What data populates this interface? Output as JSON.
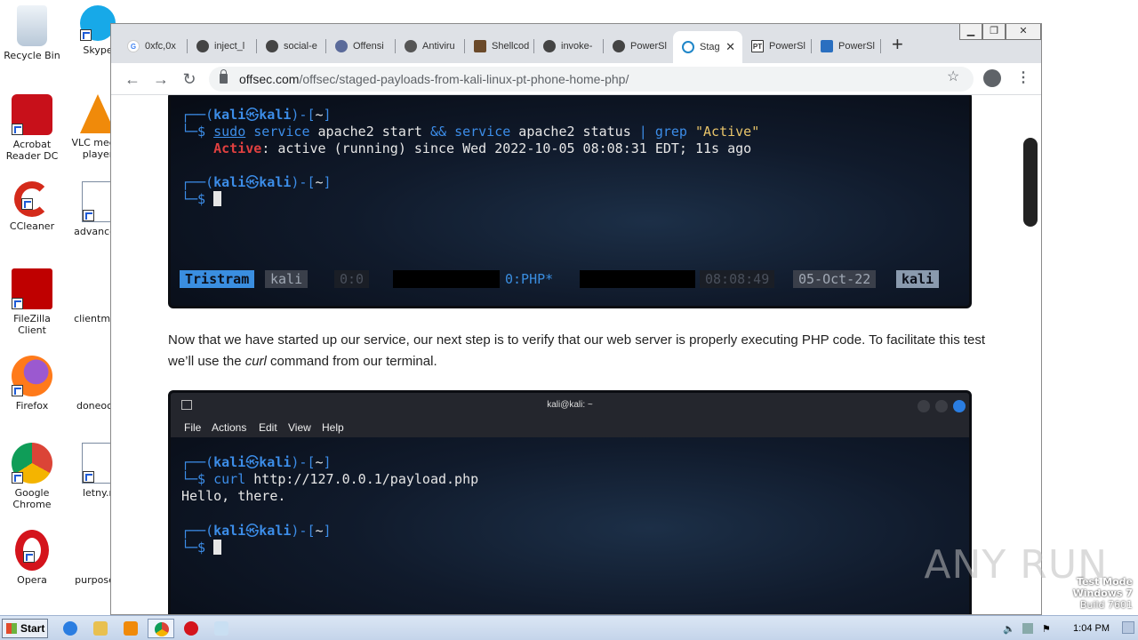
{
  "desktop": {
    "icons": [
      {
        "label": "Recycle Bin"
      },
      {
        "label": "Skype"
      },
      {
        "label": "Acrobat Reader DC"
      },
      {
        "label": "VLC media player"
      },
      {
        "label": "CCleaner"
      },
      {
        "label": "advanced"
      },
      {
        "label": "FileZilla Client"
      },
      {
        "label": "clientmail"
      },
      {
        "label": "Firefox"
      },
      {
        "label": "doneoct."
      },
      {
        "label": "Google Chrome"
      },
      {
        "label": "letny.r"
      },
      {
        "label": "Opera"
      },
      {
        "label": "purposed"
      }
    ]
  },
  "browser": {
    "tabs": [
      {
        "label": "0xfc,0x",
        "favicon": "google-icon"
      },
      {
        "label": "inject_l",
        "favicon": "github-icon"
      },
      {
        "label": "social-e",
        "favicon": "github-icon"
      },
      {
        "label": "Offensi",
        "favicon": "offsec-icon"
      },
      {
        "label": "Antiviru",
        "favicon": "globe-icon"
      },
      {
        "label": "Shellcod",
        "favicon": "shellcode-icon"
      },
      {
        "label": "invoke-",
        "favicon": "github-icon"
      },
      {
        "label": "PowerSl",
        "favicon": "github-icon"
      },
      {
        "label": "Stag",
        "favicon": "offsec-icon",
        "active": true
      },
      {
        "label": "PowerSl",
        "favicon": "pt-icon"
      },
      {
        "label": "PowerSl",
        "favicon": "powershell-icon"
      }
    ],
    "url_domain": "offsec.com",
    "url_path": "/offsec/staged-payloads-from-kali-linux-pt-phone-home-php/"
  },
  "article": {
    "terminal1": {
      "prompt1_user": "kali",
      "prompt1_host": "kali",
      "prompt_dir": "~",
      "cmd_sudo": "sudo",
      "cmd_service1": "service",
      "cmd_args1": " apache2 start ",
      "cmd_and": "&&",
      "cmd_service2": "service",
      "cmd_args2": " apache2 status ",
      "cmd_pipe": "|",
      "cmd_grep": "grep",
      "cmd_pattern": "\"Active\"",
      "out_active": "Active",
      "out_rest": ": active (running) since Wed 2022-10-05 08:08:31 EDT; 11s ago",
      "status_session": "Tristram",
      "status_host": "kali",
      "status_win0": "0:0",
      "status_win1": "0:PHP*",
      "status_time": "08:08:49",
      "status_date": "05-Oct-22",
      "status_right": "kali"
    },
    "paragraph_before": "Now that we have started up our service, our next step is to verify that our web server is properly executing PHP code. To facilitate this test we’ll use the ",
    "paragraph_em": "curl",
    "paragraph_after": " command from our terminal.",
    "terminal2": {
      "title": "kali@kali: ~",
      "menu": [
        "File",
        "Actions",
        "Edit",
        "View",
        "Help"
      ],
      "prompt_user": "kali",
      "prompt_host": "kali",
      "prompt_dir": "~",
      "cmd": "curl",
      "cmd_arg": " http://127.0.0.1/payload.php",
      "output": "Hello, there."
    }
  },
  "watermark": "ANY RUN",
  "testmode": [
    "Test Mode",
    "Windows 7",
    "Build 7601"
  ],
  "taskbar": {
    "start_label": "Start",
    "clock": "1:04 PM"
  }
}
